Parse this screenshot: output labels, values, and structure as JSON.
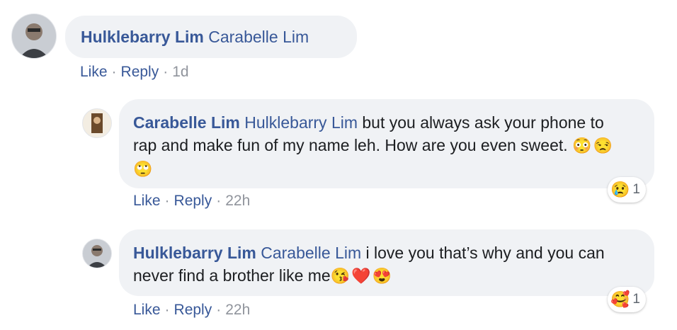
{
  "comments": [
    {
      "author": "Hulklebarry Lim",
      "mention": "Carabelle Lim",
      "text": "",
      "emojis": "",
      "actions": {
        "like": "Like",
        "reply": "Reply",
        "time": "1d"
      }
    },
    {
      "author": "Carabelle Lim",
      "mention": "Hulklebarry Lim",
      "text": " but you always ask your phone to rap and make fun of my name leh. How are you even sweet. ",
      "emojis": "😳😒🙄",
      "actions": {
        "like": "Like",
        "reply": "Reply",
        "time": "22h"
      },
      "reaction": {
        "icon": "😢",
        "count": "1"
      }
    },
    {
      "author": "Hulklebarry Lim",
      "mention": "Carabelle Lim",
      "text": " i love you that’s why and you can never find a brother like me",
      "emojis": "😘❤️😍",
      "actions": {
        "like": "Like",
        "reply": "Reply",
        "time": "22h"
      },
      "reaction": {
        "icon": "🥰",
        "count": "1"
      }
    }
  ],
  "separator": "·"
}
